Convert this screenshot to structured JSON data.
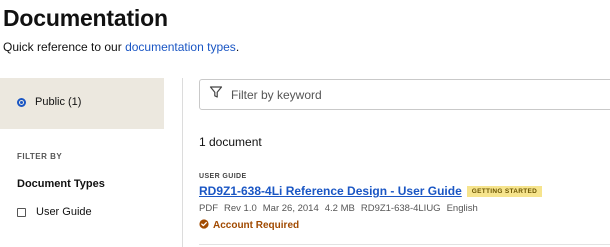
{
  "header": {
    "title": "Documentation",
    "subtitle_prefix": "Quick reference to our ",
    "subtitle_link": "documentation types",
    "subtitle_suffix": "."
  },
  "sidebar": {
    "visibility_option": "Public (1)",
    "filter_by_label": "FILTER BY",
    "document_types_heading": "Document Types",
    "document_type_options": [
      "User Guide"
    ]
  },
  "search": {
    "placeholder": "Filter by keyword",
    "value": "",
    "icon": "filter-icon"
  },
  "results": {
    "count_text": "1 document",
    "items": [
      {
        "category": "USER GUIDE",
        "title": "RD9Z1-638-4Li Reference Design - User Guide",
        "badge": "GETTING STARTED",
        "meta": {
          "format": "PDF",
          "revision": "Rev 1.0",
          "date": "Mar 26, 2014",
          "size": "4.2 MB",
          "part_number": "RD9Z1-638-4LIUG",
          "language": "English"
        },
        "access": "Account Required",
        "access_icon": "badge-check-icon"
      }
    ]
  },
  "colors": {
    "link": "#1a56c4",
    "panel_bg": "#ece8df",
    "badge_bg": "#f6e48d",
    "account_required": "#a14a00"
  }
}
